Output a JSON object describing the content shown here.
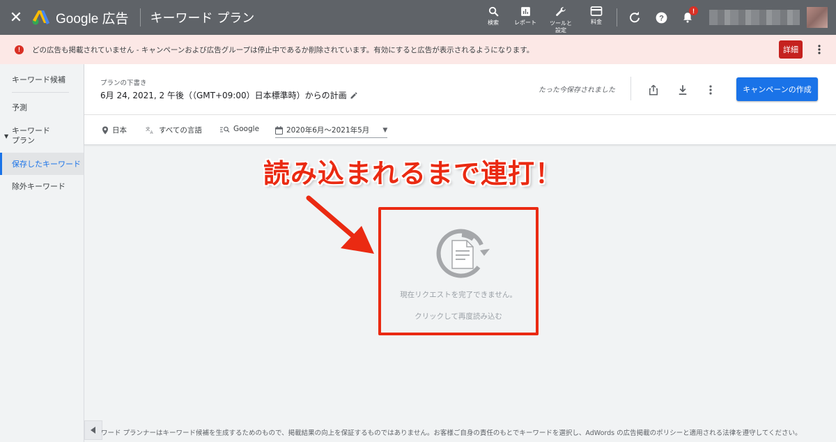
{
  "topbar": {
    "brand": "Google 広告",
    "page_title": "キーワード プラン",
    "tools": [
      {
        "label": "検索",
        "icon": "search-icon"
      },
      {
        "label": "レポート",
        "icon": "report-icon"
      },
      {
        "label": "ツールと\n設定",
        "icon": "wrench-icon"
      },
      {
        "label": "料金",
        "icon": "credit-card-icon"
      }
    ],
    "notification_badge": "!"
  },
  "alert": {
    "text": "どの広告も掲載されていません - キャンペーンおよび広告グループは停止中であるか削除されています。有効にすると広告が表示されるようになります。",
    "button_label": "詳細",
    "icon_glyph": "!"
  },
  "sidebar": {
    "items": [
      {
        "label": "キーワード候補",
        "active": false
      },
      {
        "label": "予測",
        "active": false
      },
      {
        "label": "キーワード\nプラン",
        "active": false
      },
      {
        "label": "保存したキーワード",
        "active": true
      },
      {
        "label": "除外キーワード",
        "active": false
      }
    ]
  },
  "plan": {
    "label": "プランの下書き",
    "name": "6月 24, 2021, 2 午後（（GMT+09:00）日本標準時）からの計画",
    "saved_status": "たった今保存されました",
    "create_button": "キャンペーンの作成"
  },
  "filters": {
    "location": "日本",
    "language": "すべての言語",
    "network": "Google",
    "date_range": "2020年6月～2021年5月"
  },
  "annotation": {
    "text": "読み込まれるまで連打！"
  },
  "error": {
    "message": "現在リクエストを完了できません。",
    "reload_link": "クリックして再度読み込む"
  },
  "footer": {
    "disclaimer": "ワード プランナーはキーワード候補を生成するためのもので、掲載結果の向上を保証するものではありません。お客様ご自身の責任のもとでキーワードを選択し、AdWords の広告掲載のポリシーと適用される法律を遵守してください。"
  },
  "colors": {
    "topbar": "#5f6368",
    "alert_bg": "#fce8e6",
    "alert_red": "#c5221f",
    "primary_blue": "#1a73e8",
    "annotation_red": "#ea2a12"
  }
}
